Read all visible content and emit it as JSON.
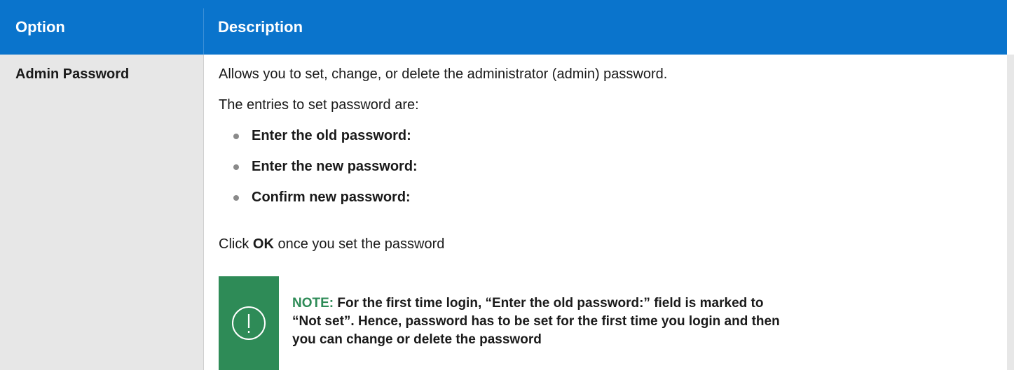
{
  "header": {
    "option": "Option",
    "description": "Description"
  },
  "row": {
    "option": "Admin Password",
    "para1": "Allows you to set, change, or delete the administrator (admin) password.",
    "para2": "The entries to set password are:",
    "bullets": [
      "Enter the old password:",
      "Enter the new password:",
      "Confirm new password:"
    ],
    "click_prefix": "Click ",
    "click_bold": "OK",
    "click_suffix": " once you set the password",
    "note_label": "NOTE:",
    "note_text": " For the first time login, “Enter the old password:” field is marked to “Not set”. Hence, password has to be set for the first time you login and then you can change or delete the password",
    "note_icon": "exclamation-circle-icon"
  },
  "colors": {
    "header_bg": "#0a74cc",
    "option_col_bg": "#e7e7e7",
    "note_green": "#2e8b57"
  }
}
